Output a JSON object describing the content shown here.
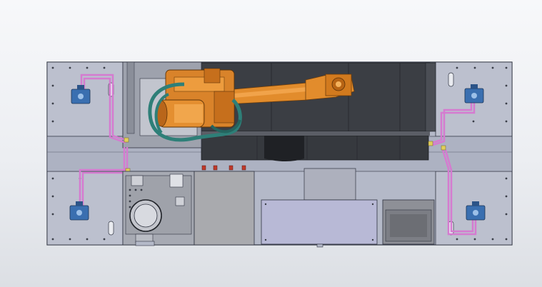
{
  "scene": {
    "colors": {
      "background_top": "#f7f8fa",
      "background_bottom": "#dcdfe4",
      "base_plate": "#b7bccb",
      "plate_border": "#2f3340",
      "robot_orange": "#e08a2a",
      "robot_dark": "#8a4f13",
      "cable_teal": "#2d7f79",
      "pipe_pink": "#d87ad2",
      "valve_blue": "#3a6fb0",
      "track_dark": "#3a3d42",
      "cabinet_grey": "#a9aaae",
      "panel_lavender": "#b8b9d6"
    },
    "icons": [
      "hydraulic-valve-icon",
      "slot-hole-icon",
      "bolt-hole-icon"
    ]
  }
}
